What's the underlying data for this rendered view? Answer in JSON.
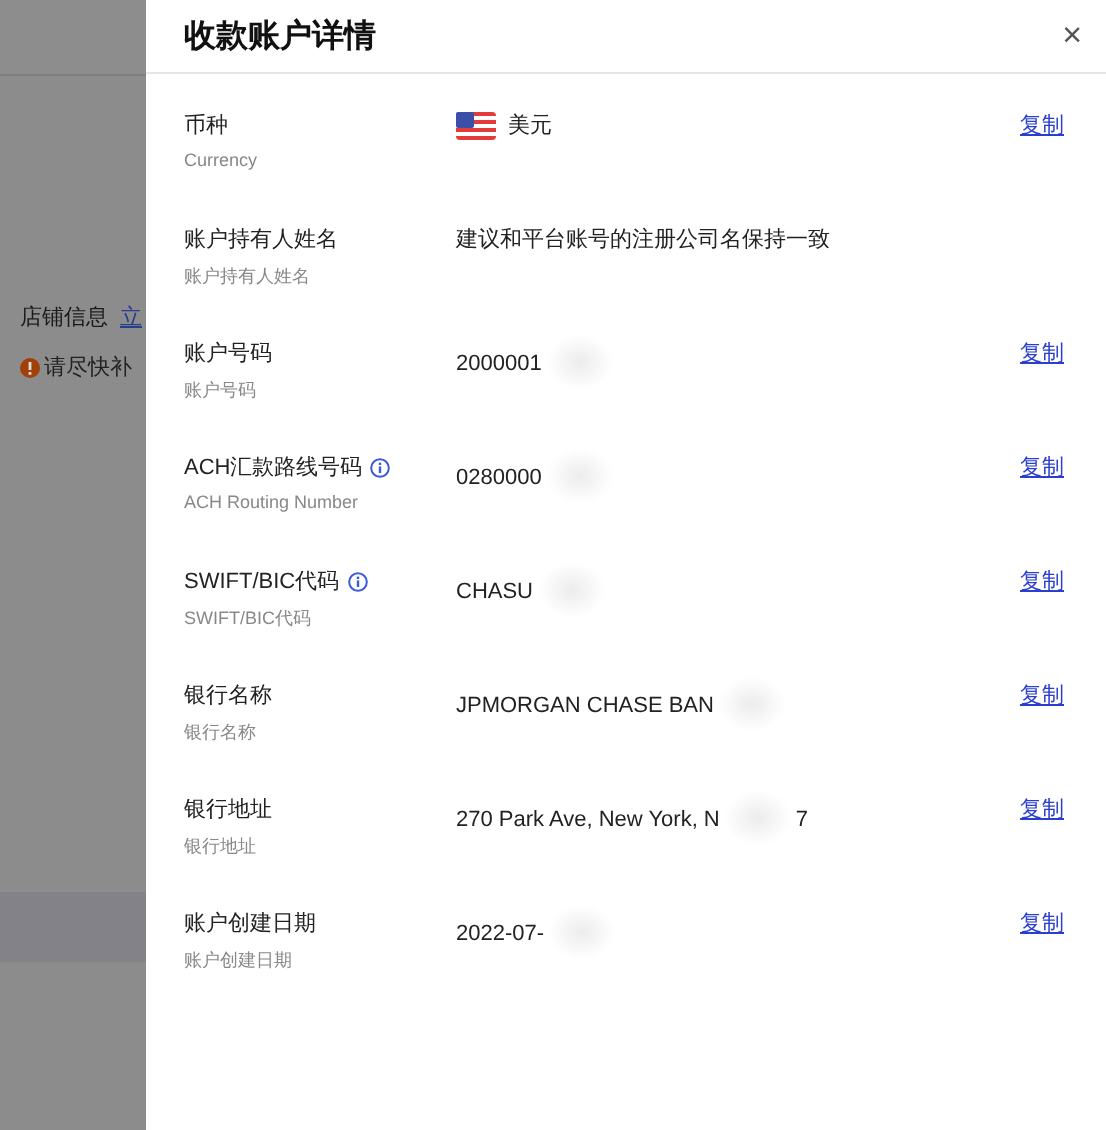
{
  "background": {
    "section_title": "店铺信息",
    "link": "立",
    "warning": "请尽快补"
  },
  "drawer": {
    "title": "收款账户详情",
    "close": "×",
    "rows": [
      {
        "label": "币种",
        "sublabel": "Currency",
        "value": "美元",
        "flag": true,
        "info": false,
        "blurred": false,
        "copy": "复制"
      },
      {
        "label": "账户持有人姓名",
        "sublabel": "账户持有人姓名",
        "value": "建议和平台账号的注册公司名保持一致",
        "flag": false,
        "info": false,
        "blurred": false
      },
      {
        "label": "账户号码",
        "sublabel": "账户号码",
        "value": "2000001",
        "flag": false,
        "info": false,
        "blurred": true,
        "copy": "复制"
      },
      {
        "label": "ACH汇款路线号码",
        "sublabel": "ACH Routing Number",
        "value": "0280000",
        "flag": false,
        "info": true,
        "blurred": true,
        "copy": "复制"
      },
      {
        "label": "SWIFT/BIC代码",
        "sublabel": "SWIFT/BIC代码",
        "value": "CHASU",
        "flag": false,
        "info": true,
        "blurred": true,
        "copy": "复制"
      },
      {
        "label": "银行名称",
        "sublabel": "银行名称",
        "value": "JPMORGAN CHASE BAN",
        "flag": false,
        "info": false,
        "blurred": true,
        "copy": "复制"
      },
      {
        "label": "银行地址",
        "sublabel": "银行地址",
        "value": "270 Park Ave, New York, N",
        "value_tail": "7",
        "flag": false,
        "info": false,
        "blurred": true,
        "copy": "复制"
      },
      {
        "label": "账户创建日期",
        "sublabel": "账户创建日期",
        "value": "2022-07-",
        "flag": false,
        "info": false,
        "blurred": true,
        "copy": "复制"
      }
    ]
  }
}
